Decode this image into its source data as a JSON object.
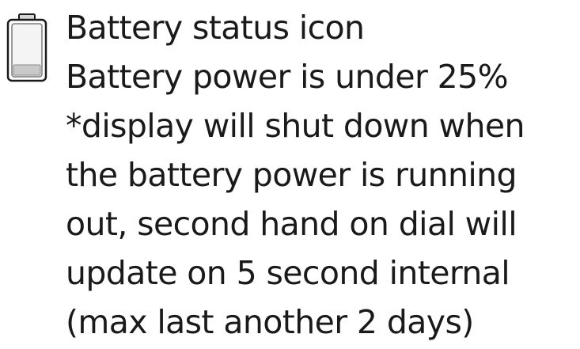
{
  "icon": {
    "name": "battery-low-icon",
    "color": "#1a1a1a",
    "fill_color": "#c9c9c9",
    "charge_level_percent": 25
  },
  "legend": {
    "title": "Battery status icon",
    "description": "Battery power is under 25%",
    "note_lines": [
      "*display will shut down when",
      "the battery power is running",
      "out, second hand on dial will",
      "update on 5 second internal",
      "(max last another 2 days)"
    ]
  }
}
